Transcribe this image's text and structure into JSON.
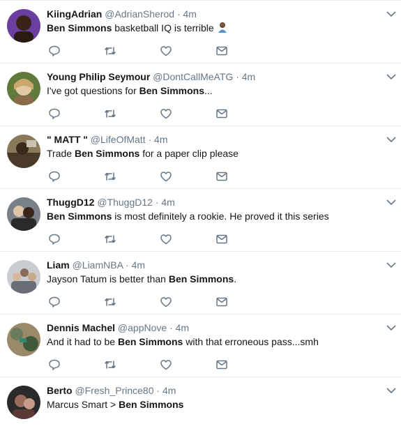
{
  "tweets": [
    {
      "name": "KiingAdrian",
      "handle": "@AdrianSherod",
      "separator": "·",
      "time": "4m",
      "text_pre": "",
      "text_bold": "Ben Simmons",
      "text_post": " basketball IQ is terrible",
      "emoji": "facepalm-emoji",
      "avatar_colors": [
        "#6b3fa0",
        "#2a1b12"
      ]
    },
    {
      "name": "Young Philip Seymour",
      "handle": "@DontCallMeATG",
      "separator": "·",
      "time": "4m",
      "text_pre": "I've got questions for ",
      "text_bold": "Ben Simmons",
      "text_post": "...",
      "avatar_colors": [
        "#5f7a3a",
        "#e2c9a6"
      ]
    },
    {
      "name": "\" MATT \"",
      "handle": "@LifeOfMatt",
      "separator": "·",
      "time": "4m",
      "text_pre": "Trade ",
      "text_bold": "Ben Simmons",
      "text_post": " for a paper clip please",
      "avatar_colors": [
        "#4a3a2a",
        "#8a7a5a"
      ]
    },
    {
      "name": "ThuggD12",
      "handle": "@ThuggD12",
      "separator": "·",
      "time": "4m",
      "text_pre": "",
      "text_bold": "Ben Simmons",
      "text_post": " is most definitely a rookie. He proved it this series",
      "avatar_colors": [
        "#7a8088",
        "#3a2418"
      ]
    },
    {
      "name": "Liam",
      "handle": "@LiamNBA",
      "separator": "·",
      "time": "4m",
      "text_pre": "Jayson Tatum is better than ",
      "text_bold": "Ben Simmons",
      "text_post": ".",
      "avatar_colors": [
        "#c9cdd2",
        "#8a6a58"
      ]
    },
    {
      "name": "Dennis Machel",
      "handle": "@appNove",
      "separator": "·",
      "time": "4m",
      "text_pre": "And it had to be ",
      "text_bold": "Ben Simmons",
      "text_post": " with that erroneous pass...smh",
      "avatar_colors": [
        "#3e5a3a",
        "#9a8a6a"
      ]
    },
    {
      "name": "Berto",
      "handle": "@Fresh_Prince80",
      "separator": "·",
      "time": "4m",
      "text_pre": "Marcus Smart > ",
      "text_bold": "Ben Simmons",
      "text_post": "",
      "avatar_colors": [
        "#2a2a2a",
        "#9a6a5a"
      ]
    }
  ],
  "icons": {
    "reply": "reply-icon",
    "retweet": "retweet-icon",
    "like": "like-icon",
    "message": "message-icon",
    "more": "chevron-down-icon"
  },
  "colors": {
    "icon_gray": "#657786",
    "divider": "#e6ecf0",
    "text": "#14171a"
  }
}
